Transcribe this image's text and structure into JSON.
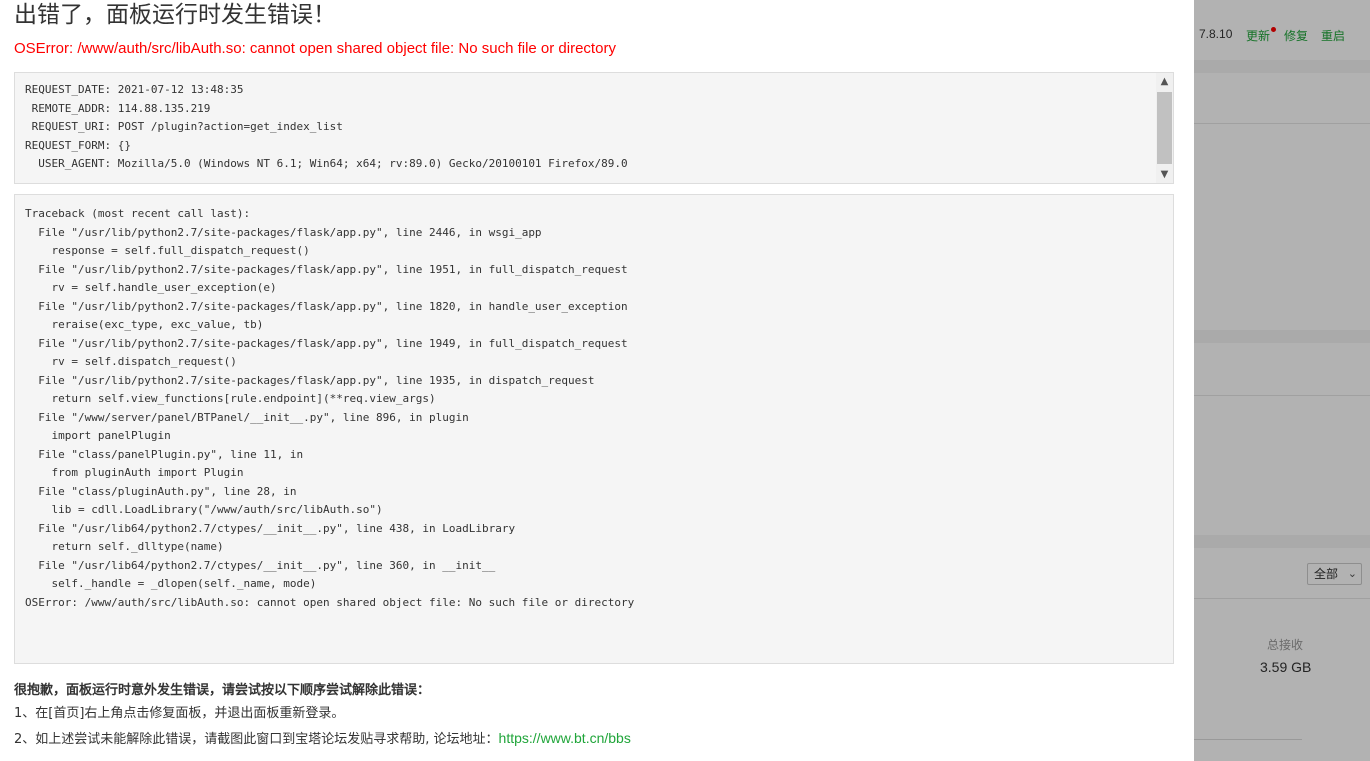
{
  "background_panel": {
    "version": "7.8.10",
    "update_label": "更新",
    "repair_label": "修复",
    "restart_label": "重启",
    "filter_select_value": "全部",
    "total_received_label": "总接收",
    "total_received_value": "3.59 GB"
  },
  "error_dialog": {
    "title": "出错了，面板运行时发生错误！",
    "message": "OSError: /www/auth/src/libAuth.so: cannot open shared object file: No such file or directory",
    "request_info": [
      "REQUEST_DATE: 2021-07-12 13:48:35",
      " REMOTE_ADDR: 114.88.135.219",
      " REQUEST_URI: POST /plugin?action=get_index_list",
      "REQUEST_FORM: {}",
      "  USER_AGENT: Mozilla/5.0 (Windows NT 6.1; Win64; x64; rv:89.0) Gecko/20100101 Firefox/89.0"
    ],
    "traceback": [
      "Traceback (most recent call last):",
      "  File \"/usr/lib/python2.7/site-packages/flask/app.py\", line 2446, in wsgi_app",
      "    response = self.full_dispatch_request()",
      "  File \"/usr/lib/python2.7/site-packages/flask/app.py\", line 1951, in full_dispatch_request",
      "    rv = self.handle_user_exception(e)",
      "  File \"/usr/lib/python2.7/site-packages/flask/app.py\", line 1820, in handle_user_exception",
      "    reraise(exc_type, exc_value, tb)",
      "  File \"/usr/lib/python2.7/site-packages/flask/app.py\", line 1949, in full_dispatch_request",
      "    rv = self.dispatch_request()",
      "  File \"/usr/lib/python2.7/site-packages/flask/app.py\", line 1935, in dispatch_request",
      "    return self.view_functions[rule.endpoint](**req.view_args)",
      "  File \"/www/server/panel/BTPanel/__init__.py\", line 896, in plugin",
      "    import panelPlugin",
      "  File \"class/panelPlugin.py\", line 11, in",
      "    from pluginAuth import Plugin",
      "  File \"class/pluginAuth.py\", line 28, in",
      "    lib = cdll.LoadLibrary(\"/www/auth/src/libAuth.so\")",
      "  File \"/usr/lib64/python2.7/ctypes/__init__.py\", line 438, in LoadLibrary",
      "    return self._dlltype(name)",
      "  File \"/usr/lib64/python2.7/ctypes/__init__.py\", line 360, in __init__",
      "    self._handle = _dlopen(self._name, mode)",
      "OSError: /www/auth/src/libAuth.so: cannot open shared object file: No such file or directory"
    ],
    "help": {
      "heading": "很抱歉，面板运行时意外发生错误，请尝试按以下顺序尝试解除此错误：",
      "step1": "1、在[首页]右上角点击修复面板，并退出面板重新登录。",
      "step2": "2、如上述尝试未能解除此错误，请截图此窗口到宝塔论坛发贴寻求帮助, 论坛地址：",
      "forum_url": "https://www.bt.cn/bbs"
    }
  },
  "icons": {
    "scroll_up": "triangle-up",
    "scroll_down": "triangle-down",
    "select_arrow": "chevron-down",
    "update_badge": "red-dot"
  },
  "colors": {
    "error_red": "#ff0000",
    "link_green": "#20a53a"
  }
}
